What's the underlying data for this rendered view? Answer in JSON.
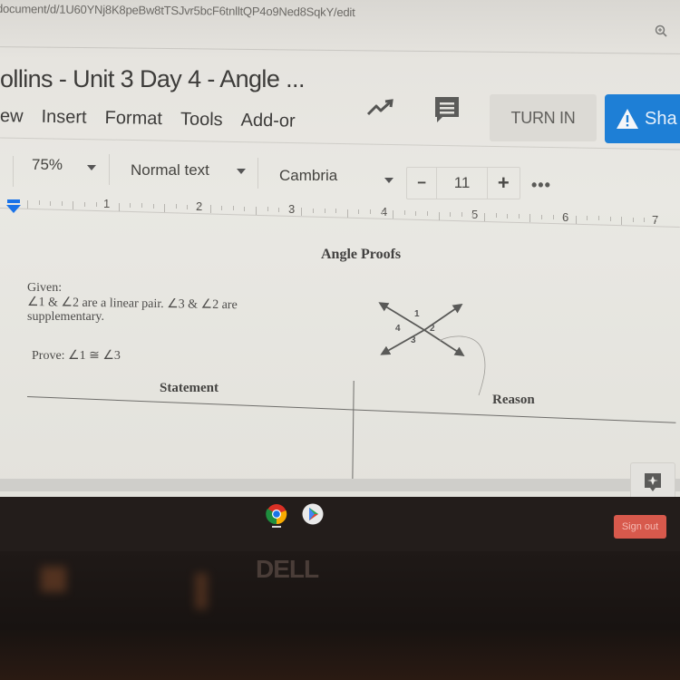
{
  "browser": {
    "url": "document/d/1U60YNj8K8peBw8tTSJvr5bcF6tnlltQP4o9Ned8SqkY/edit",
    "zoom_icon": "zoom-in-icon"
  },
  "docs": {
    "title": "ollins - Unit 3 Day 4 - Angle ...",
    "menu": [
      "ew",
      "Insert",
      "Format",
      "Tools",
      "Add-or"
    ],
    "activity_icon": "trending-up-icon",
    "comment_icon": "comment-icon",
    "turn_in_label": "TURN IN",
    "share_label": "Sha",
    "share_icon": "warning-triangle-icon"
  },
  "toolbar": {
    "zoom": "75%",
    "style": "Normal text",
    "font": "Cambria",
    "font_size_minus": "−",
    "font_size": "11",
    "font_size_plus": "+",
    "more": "•••"
  },
  "ruler": {
    "numbers": [
      "1",
      "2",
      "3",
      "4",
      "5",
      "6",
      "7"
    ]
  },
  "document": {
    "heading": "Angle Proofs",
    "given_label": "Given:",
    "given_line1": "∠1 & ∠2 are a linear pair. ∠3 & ∠2 are",
    "given_line2": "supplementary.",
    "prove": "Prove: ∠1 ≅ ∠3",
    "diagram_labels": [
      "1",
      "2",
      "3",
      "4"
    ],
    "table_headers": {
      "statement": "Statement",
      "reason": "Reason"
    },
    "table_rows": []
  },
  "explore_icon": "explore-sparkle-icon",
  "shelf": {
    "apps": [
      "Chrome",
      "Play Store"
    ],
    "sign_out_label": "Sign out"
  },
  "bezel": {
    "brand": "DELL"
  }
}
